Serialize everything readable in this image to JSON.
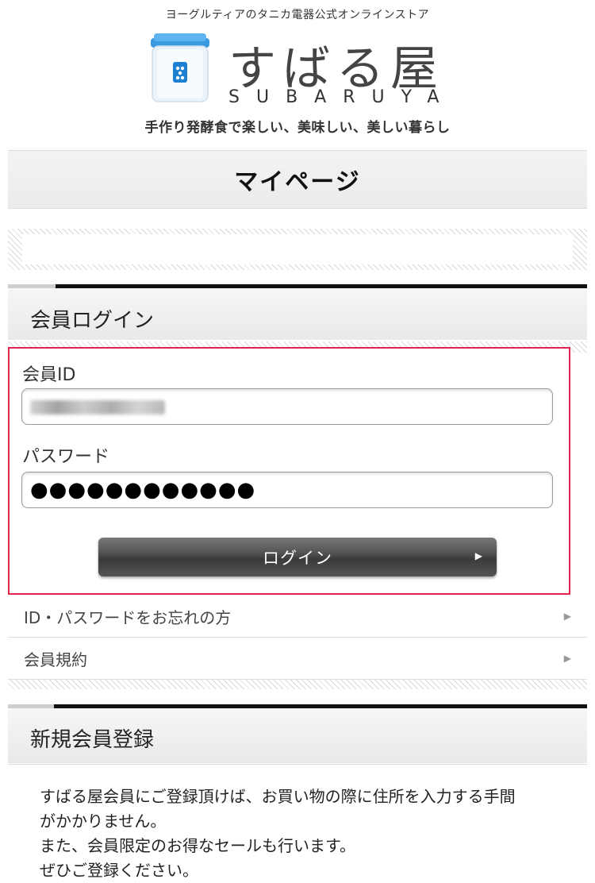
{
  "header": {
    "tagline": "ヨーグルティアのタニカ電器公式オンラインストア",
    "brand_jp": "すばる屋",
    "brand_en": "SUBARUYA",
    "slogan": "手作り発酵食で楽しい、美味しい、美しい暮らし",
    "logo_icon": "yogurt-jar-icon"
  },
  "page": {
    "title": "マイページ"
  },
  "login": {
    "section_title": "会員ログイン",
    "member_id_label": "会員ID",
    "password_label": "パスワード",
    "password_mask": "●●●●●●●●●●●●",
    "button_label": "ログイン",
    "highlight_color": "#e0244a"
  },
  "links": [
    {
      "label": "ID・パスワードをお忘れの方"
    },
    {
      "label": "会員規約"
    }
  ],
  "register": {
    "section_title": "新規会員登録",
    "lines": [
      "すばる屋会員にご登録頂けば、お買い物の際に住所を入力する手間",
      "がかかりません。",
      "また、会員限定のお得なセールも行います。",
      "ぜひご登録ください。"
    ]
  }
}
